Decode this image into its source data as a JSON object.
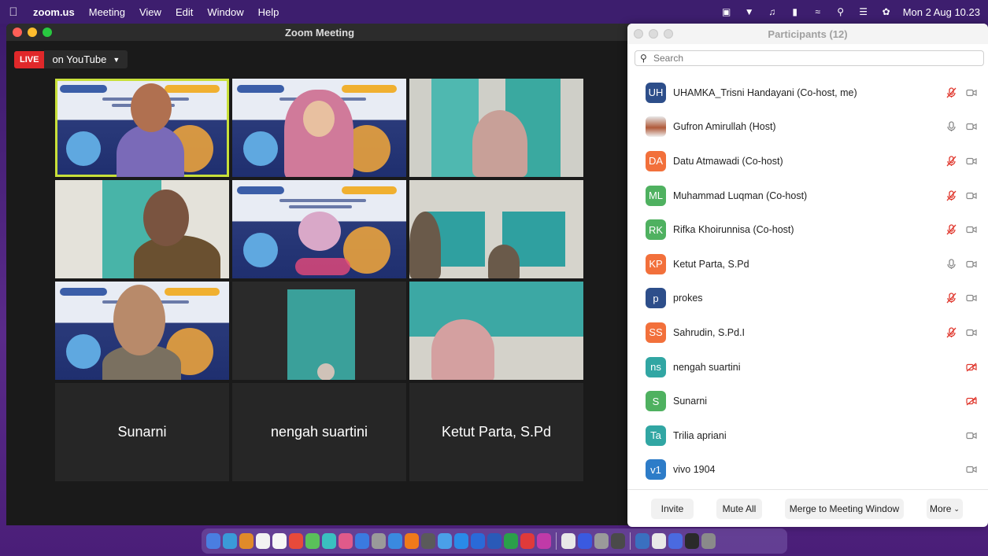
{
  "menubar": {
    "app": "zoom.us",
    "items": [
      "Meeting",
      "View",
      "Edit",
      "Window",
      "Help"
    ],
    "clock": "Mon 2 Aug 10.23"
  },
  "main_window": {
    "title": "Zoom Meeting",
    "live_badge": "LIVE",
    "live_destination": "on YouTube",
    "name_tiles": [
      "Sunarni",
      "nengah suartini",
      "Ketut Parta, S.Pd"
    ]
  },
  "participants": {
    "title": "Participants (12)",
    "search_placeholder": "Search",
    "list": [
      {
        "initials": "UH",
        "name": "UHAMKA_Trisni Handayani (Co-host, me)",
        "color": "#2d4e8a",
        "mic": "muted",
        "video": "on"
      },
      {
        "initials": "",
        "name": "Gufron Amirullah (Host)",
        "color": "",
        "mic": "on",
        "video": "on",
        "photo": true
      },
      {
        "initials": "DA",
        "name": "Datu Atmawadi (Co-host)",
        "color": "#f2703b",
        "mic": "muted",
        "video": "on"
      },
      {
        "initials": "ML",
        "name": "Muhammad Luqman (Co-host)",
        "color": "#4fb160",
        "mic": "muted",
        "video": "on"
      },
      {
        "initials": "RK",
        "name": "Rifka Khoirunnisa (Co-host)",
        "color": "#4fb160",
        "mic": "muted",
        "video": "on"
      },
      {
        "initials": "KP",
        "name": "Ketut Parta, S.Pd",
        "color": "#f2703b",
        "mic": "on",
        "video": "on"
      },
      {
        "initials": "p",
        "name": "prokes",
        "color": "#2d4e8a",
        "mic": "muted",
        "video": "on"
      },
      {
        "initials": "SS",
        "name": "Sahrudin, S.Pd.I",
        "color": "#f2703b",
        "mic": "muted",
        "video": "on"
      },
      {
        "initials": "ns",
        "name": "nengah suartini",
        "color": "#31a6a3",
        "mic": "none",
        "video": "off"
      },
      {
        "initials": "S",
        "name": "Sunarni",
        "color": "#4fb160",
        "mic": "none",
        "video": "off"
      },
      {
        "initials": "Ta",
        "name": "Trilia apriani",
        "color": "#31a6a3",
        "mic": "none",
        "video": "on"
      },
      {
        "initials": "v1",
        "name": "vivo 1904",
        "color": "#2d7cc8",
        "mic": "none",
        "video": "on"
      }
    ],
    "footer": {
      "invite": "Invite",
      "mute_all": "Mute All",
      "merge": "Merge to Meeting Window",
      "more": "More"
    }
  }
}
